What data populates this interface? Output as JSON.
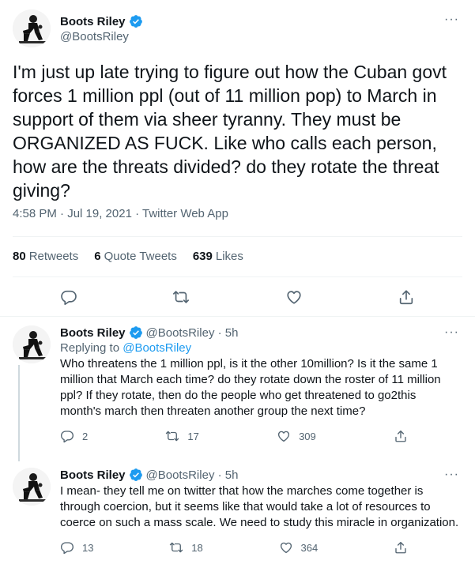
{
  "main": {
    "name": "Boots Riley",
    "handle": "@BootsRiley",
    "text": "I'm just up late trying to figure out how the Cuban govt forces 1 million ppl (out of 11 million pop) to March in support of them via sheer tyranny. They must be ORGANIZED AS FUCK. Like who calls each person, how are the threats divided? do they rotate the threat giving?",
    "timestamp": "4:58 PM · Jul 19, 2021 · Twitter Web App",
    "stats": {
      "retweets_num": "80",
      "retweets_label": "Retweets",
      "quotes_num": "6",
      "quotes_label": "Quote Tweets",
      "likes_num": "639",
      "likes_label": "Likes"
    },
    "more": "···"
  },
  "replies": [
    {
      "name": "Boots Riley",
      "handle": "@BootsRiley · 5h",
      "replying_prefix": "Replying to ",
      "replying_to": "@BootsRiley",
      "text": "Who threatens the 1 million ppl, is it the other 10million? Is it the same 1 million that March each time? do they rotate down the roster of 11 million ppl? If they rotate, then do the people who get threatened to go2this month's march then threaten another group the next time?",
      "reply_count": "2",
      "retweet_count": "17",
      "like_count": "309",
      "more": "···"
    },
    {
      "name": "Boots Riley",
      "handle": "@BootsRiley · 5h",
      "text": "I mean- they tell me on twitter that how the marches come together is through coercion, but it seems like that would take a lot of resources to coerce on such a mass scale. We need to study this miracle in organization.",
      "reply_count": "13",
      "retweet_count": "18",
      "like_count": "364",
      "more": "···"
    }
  ],
  "colors": {
    "accent": "#1d9bf0",
    "text_primary": "#0f1419",
    "text_secondary": "#536471",
    "divider": "#eff3f4"
  },
  "icons": [
    "verified-badge-icon",
    "more-icon",
    "reply-icon",
    "retweet-icon",
    "like-icon",
    "share-icon"
  ]
}
